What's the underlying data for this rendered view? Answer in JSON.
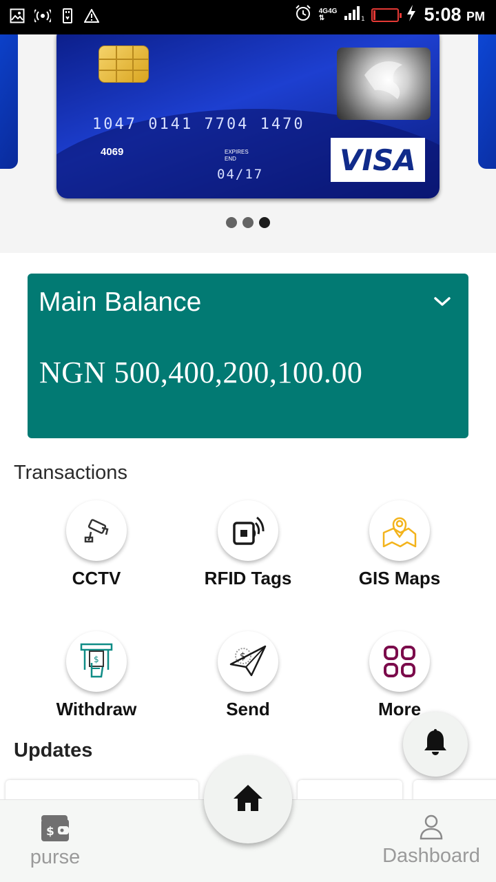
{
  "status_bar": {
    "time": "5:08",
    "ampm": "PM",
    "network": "4G",
    "network2": "4G",
    "sim_slot": "1",
    "icons": [
      "image-icon",
      "hotspot-icon",
      "usb-icon",
      "warning-icon",
      "alarm-icon",
      "signal-icon",
      "battery-icon",
      "charging-icon"
    ]
  },
  "card": {
    "number": "1047  0141  7704  1470",
    "sub_number": "4069",
    "expires_label": "EXPIRES",
    "end_label": "END",
    "expiry": "04/17",
    "brand": "VISA"
  },
  "carousel": {
    "pages": 3,
    "active_index": 2
  },
  "balance": {
    "title": "Main Balance",
    "amount": "NGN 500,400,200,100.00"
  },
  "transactions": {
    "title": "Transactions",
    "items": [
      {
        "label": "CCTV",
        "icon": "cctv-camera-icon"
      },
      {
        "label": "RFID Tags",
        "icon": "rfid-tag-icon"
      },
      {
        "label": "GIS Maps",
        "icon": "map-pin-icon"
      },
      {
        "label": "Withdraw",
        "icon": "atm-withdraw-icon"
      },
      {
        "label": "Send",
        "icon": "send-money-icon"
      },
      {
        "label": "More",
        "icon": "grid-more-icon"
      }
    ]
  },
  "updates": {
    "title": "Updates"
  },
  "bottom_nav": {
    "purse_label": "purse",
    "dashboard_label": "Dashboard"
  },
  "colors": {
    "balance_bg": "#027a73",
    "card_blue": "#1d3fd0",
    "gis_icon": "#f3b31b",
    "more_icon": "#7b0b4b",
    "withdraw_icon": "#0f8c86"
  }
}
